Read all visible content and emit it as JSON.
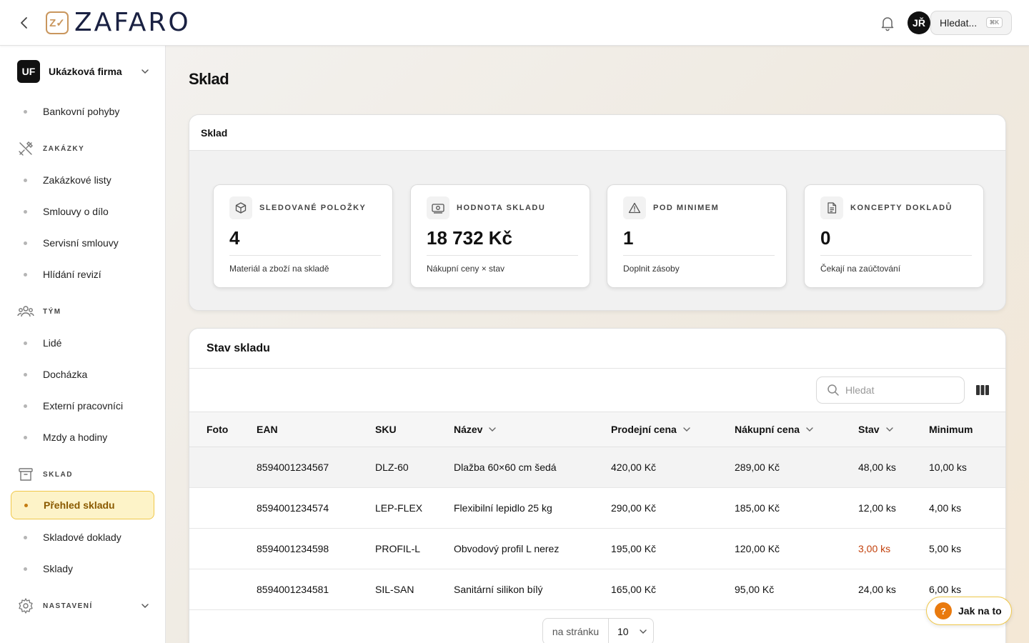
{
  "header": {
    "logo_mark": "Z✓",
    "logo_text": "ZAFARO",
    "avatar_initials": "JŘ",
    "search_label": "Hledat...",
    "search_shortcut": "⌘K"
  },
  "sidebar": {
    "company_initials": "UF",
    "company_name": "Ukázková firma",
    "items_top": [
      {
        "label": "Bankovní pohyby"
      }
    ],
    "sections": [
      {
        "label": "ZAKÁZKY",
        "icon": "tools-icon",
        "items": [
          {
            "label": "Zakázkové listy"
          },
          {
            "label": "Smlouvy o dílo"
          },
          {
            "label": "Servisní smlouvy"
          },
          {
            "label": "Hlídání revizí"
          }
        ]
      },
      {
        "label": "TÝM",
        "icon": "team-icon",
        "items": [
          {
            "label": "Lidé"
          },
          {
            "label": "Docházka"
          },
          {
            "label": "Externí pracovníci"
          },
          {
            "label": "Mzdy a hodiny"
          }
        ]
      },
      {
        "label": "SKLAD",
        "icon": "archive-icon",
        "items": [
          {
            "label": "Přehled skladu",
            "active": true
          },
          {
            "label": "Skladové doklady"
          },
          {
            "label": "Sklady"
          }
        ]
      },
      {
        "label": "NASTAVENÍ",
        "icon": "gear-icon",
        "items": []
      }
    ]
  },
  "page": {
    "title": "Sklad"
  },
  "overview": {
    "title": "Sklad",
    "kpis": [
      {
        "icon": "box-icon",
        "label": "SLEDOVANÉ POLOŽKY",
        "value": "4",
        "sub": "Materiál a zboží na skladě"
      },
      {
        "icon": "money-icon",
        "label": "HODNOTA SKLADU",
        "value": "18 732 Kč",
        "sub": "Nákupní ceny × stav"
      },
      {
        "icon": "warning-icon",
        "label": "POD MINIMEM",
        "value": "1",
        "sub": "Doplnit zásoby"
      },
      {
        "icon": "document-icon",
        "label": "KONCEPTY DOKLADŮ",
        "value": "0",
        "sub": "Čekají na zaúčtování"
      }
    ]
  },
  "stock": {
    "title": "Stav skladu",
    "search_placeholder": "Hledat",
    "columns": [
      "Foto",
      "EAN",
      "SKU",
      "Název",
      "Prodejní cena",
      "Nákupní cena",
      "Stav",
      "Minimum"
    ],
    "rows": [
      {
        "foto": "",
        "ean": "8594001234567",
        "sku": "DLZ-60",
        "name": "Dlažba 60×60 cm šedá",
        "sell": "420,00 Kč",
        "buy": "289,00 Kč",
        "stock": "48,00 ks",
        "min": "10,00 ks",
        "low": false
      },
      {
        "foto": "",
        "ean": "8594001234574",
        "sku": "LEP-FLEX",
        "name": "Flexibilní lepidlo 25 kg",
        "sell": "290,00 Kč",
        "buy": "185,00 Kč",
        "stock": "12,00 ks",
        "min": "4,00 ks",
        "low": false
      },
      {
        "foto": "",
        "ean": "8594001234598",
        "sku": "PROFIL-L",
        "name": "Obvodový profil L nerez",
        "sell": "195,00 Kč",
        "buy": "120,00 Kč",
        "stock": "3,00 ks",
        "min": "5,00 ks",
        "low": true
      },
      {
        "foto": "",
        "ean": "8594001234581",
        "sku": "SIL-SAN",
        "name": "Sanitární silikon bílý",
        "sell": "165,00 Kč",
        "buy": "95,00 Kč",
        "stock": "24,00 ks",
        "min": "6,00 ks",
        "low": false
      }
    ],
    "per_page_label": "na stránku",
    "per_page_value": "10"
  },
  "help": {
    "label": "Jak na to",
    "icon_text": "?"
  },
  "colors": {
    "accent": "#f0c84a",
    "low_stock": "#c2410c",
    "help_orange": "#e97a0e"
  }
}
